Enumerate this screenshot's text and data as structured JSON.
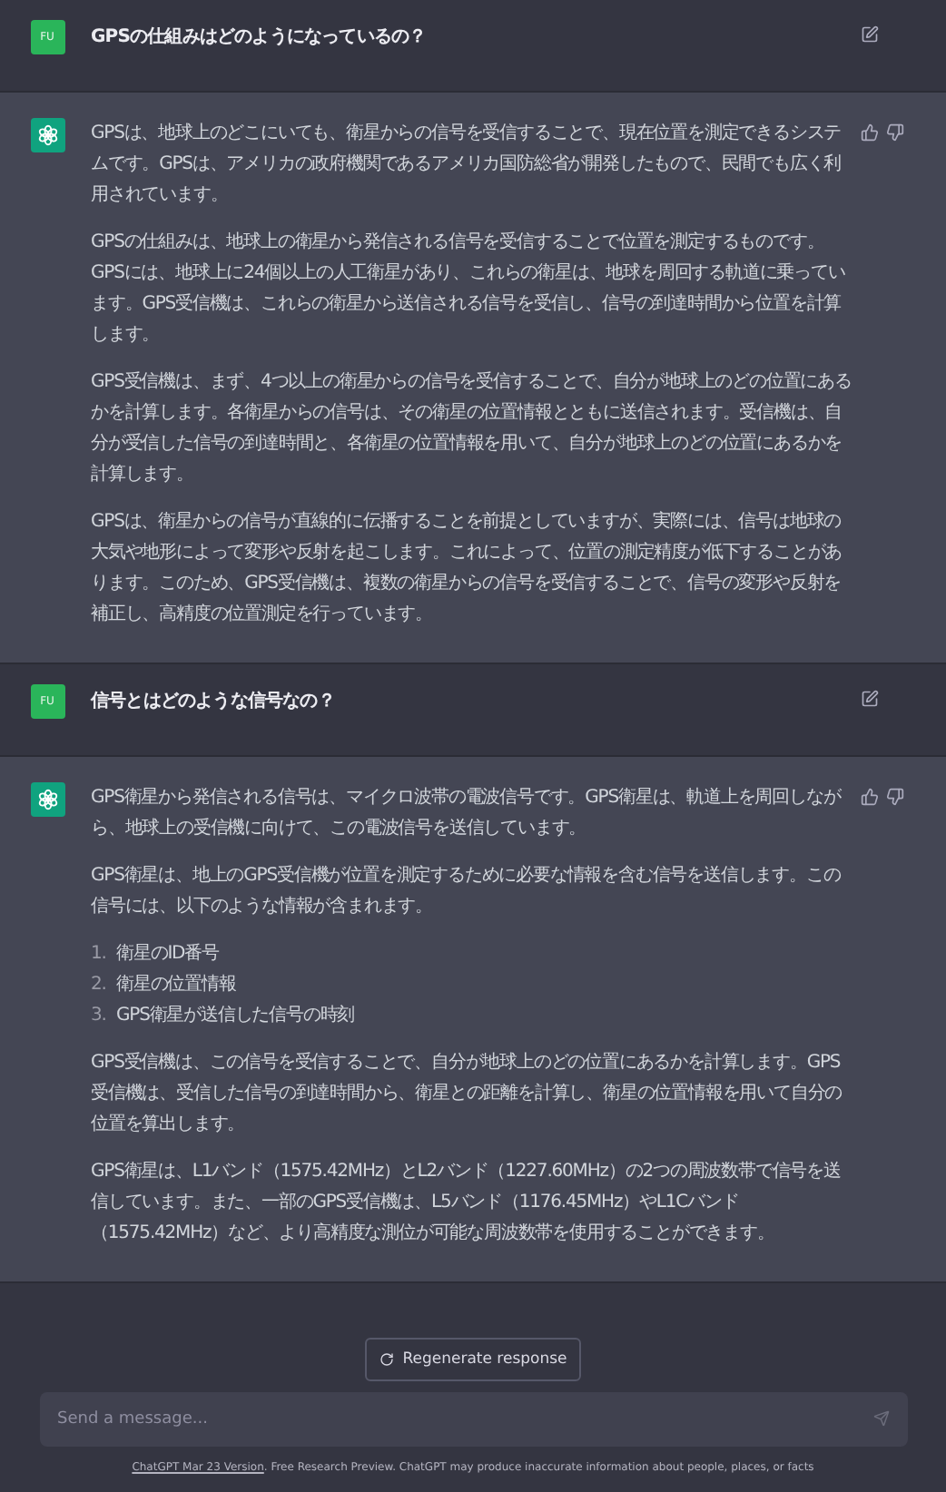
{
  "messages": [
    {
      "kind": "user",
      "avatar": "FU",
      "text": "GPSの仕組みはどのようになっているの？"
    },
    {
      "kind": "assistant",
      "blocks": [
        {
          "kind": "paragraph",
          "text": "GPSは、地球上のどこにいても、衛星からの信号を受信することで、現在位置を測定できるシステムです。GPSは、アメリカの政府機関であるアメリカ国防総省が開発したもので、民間でも広く利用されています。"
        },
        {
          "kind": "paragraph",
          "text": "GPSの仕組みは、地球上の衛星から発信される信号を受信することで位置を測定するものです。GPSには、地球上に24個以上の人工衛星があり、これらの衛星は、地球を周回する軌道に乗っています。GPS受信機は、これらの衛星から送信される信号を受信し、信号の到達時間から位置を計算します。"
        },
        {
          "kind": "paragraph",
          "text": "GPS受信機は、まず、4つ以上の衛星からの信号を受信することで、自分が地球上のどの位置にあるかを計算します。各衛星からの信号は、その衛星の位置情報とともに送信されます。受信機は、自分が受信した信号の到達時間と、各衛星の位置情報を用いて、自分が地球上のどの位置にあるかを計算します。"
        },
        {
          "kind": "paragraph",
          "text": "GPSは、衛星からの信号が直線的に伝播することを前提としていますが、実際には、信号は地球の大気や地形によって変形や反射を起こします。これによって、位置の測定精度が低下することがあります。このため、GPS受信機は、複数の衛星からの信号を受信することで、信号の変形や反射を補正し、高精度の位置測定を行っています。"
        }
      ]
    },
    {
      "kind": "user",
      "avatar": "FU",
      "text": "信号とはどのような信号なの？"
    },
    {
      "kind": "assistant",
      "blocks": [
        {
          "kind": "paragraph",
          "text": "GPS衛星から発信される信号は、マイクロ波帯の電波信号です。GPS衛星は、軌道上を周回しながら、地球上の受信機に向けて、この電波信号を送信しています。"
        },
        {
          "kind": "paragraph",
          "text": "GPS衛星は、地上のGPS受信機が位置を測定するために必要な情報を含む信号を送信します。この信号には、以下のような情報が含まれます。"
        },
        {
          "kind": "list",
          "items": [
            {
              "number": "1.",
              "text": "衛星のID番号"
            },
            {
              "number": "2.",
              "text": "衛星の位置情報"
            },
            {
              "number": "3.",
              "text": "GPS衛星が送信した信号の時刻"
            }
          ]
        },
        {
          "kind": "paragraph",
          "text": "GPS受信機は、この信号を受信することで、自分が地球上のどの位置にあるかを計算します。GPS受信機は、受信した信号の到達時間から、衛星との距離を計算し、衛星の位置情報を用いて自分の位置を算出します。"
        },
        {
          "kind": "paragraph",
          "text": "GPS衛星は、L1バンド（1575.42MHz）とL2バンド（1227.60MHz）の2つの周波数帯で信号を送信しています。また、一部のGPS受信機は、L5バンド（1176.45MHz）やL1Cバンド（1575.42MHz）など、より高精度な測位が可能な周波数帯を使用することができます。"
        }
      ]
    }
  ],
  "regenerate": "Regenerate response",
  "composer": {
    "placeholder": "Send a message..."
  },
  "footer": {
    "link": "ChatGPT Mar 23 Version",
    "text": ". Free Research Preview. ChatGPT may produce inaccurate information about people, places, or facts"
  }
}
